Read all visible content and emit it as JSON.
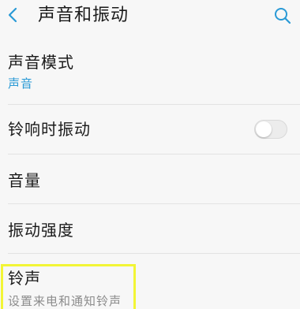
{
  "header": {
    "title": "声音和振动",
    "back_icon": "chevron-left-icon",
    "search_icon": "search-icon"
  },
  "colors": {
    "accent": "#2a9ad6",
    "subtext_gray": "#8c8c8c",
    "highlight": "#f2f535"
  },
  "rows": {
    "sound_mode": {
      "label": "声音模式",
      "value": "声音"
    },
    "ring_vibrate": {
      "label": "铃响时振动",
      "toggle_on": false
    },
    "volume": {
      "label": "音量"
    },
    "vibration_strength": {
      "label": "振动强度"
    },
    "ringtone": {
      "label": "铃声",
      "description": "设置来电和通知铃声"
    }
  }
}
